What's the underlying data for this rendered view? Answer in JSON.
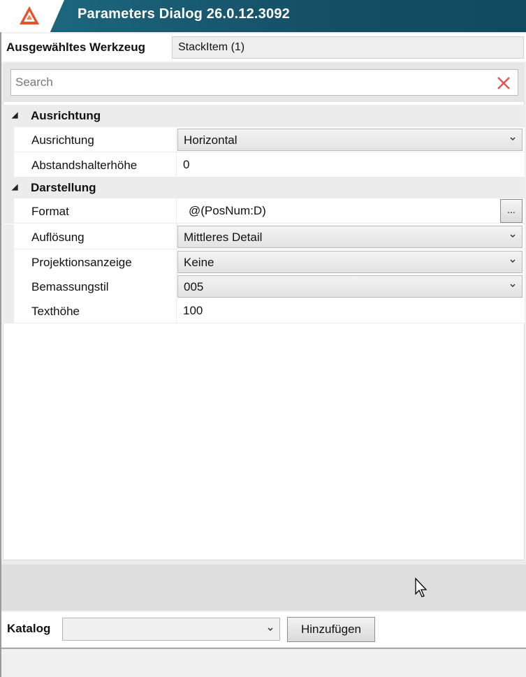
{
  "window": {
    "title": "Parameters Dialog 26.0.12.3092",
    "brand_color": "#1e6b82",
    "logo_icon": "app-logo-icon"
  },
  "selected_tool": {
    "label": "Ausgewähltes Werkzeug",
    "value": "StackItem (1)"
  },
  "search": {
    "placeholder": "Search",
    "clear_icon": "close-icon"
  },
  "groups": [
    {
      "title": "Ausrichtung",
      "properties": [
        {
          "name": "Ausrichtung",
          "value": "Horizontal",
          "control": "dropdown"
        },
        {
          "name": "Abstandshalterhöhe",
          "value": "0",
          "control": "text"
        }
      ]
    },
    {
      "title": "Darstellung",
      "properties": [
        {
          "name": "Format",
          "value": "@(PosNum:D)",
          "control": "text-with-button",
          "button_label": "..."
        },
        {
          "name": "Auflösung",
          "value": "Mittleres Detail",
          "control": "dropdown"
        },
        {
          "name": "Projektionsanzeige",
          "value": "Keine",
          "control": "dropdown"
        },
        {
          "name": "Bemassungstil",
          "value": "005",
          "control": "dropdown"
        },
        {
          "name": "Texthöhe",
          "value": "100",
          "control": "text"
        }
      ]
    }
  ],
  "catalog": {
    "label": "Katalog",
    "selected": "",
    "add_button_label": "Hinzufügen"
  }
}
